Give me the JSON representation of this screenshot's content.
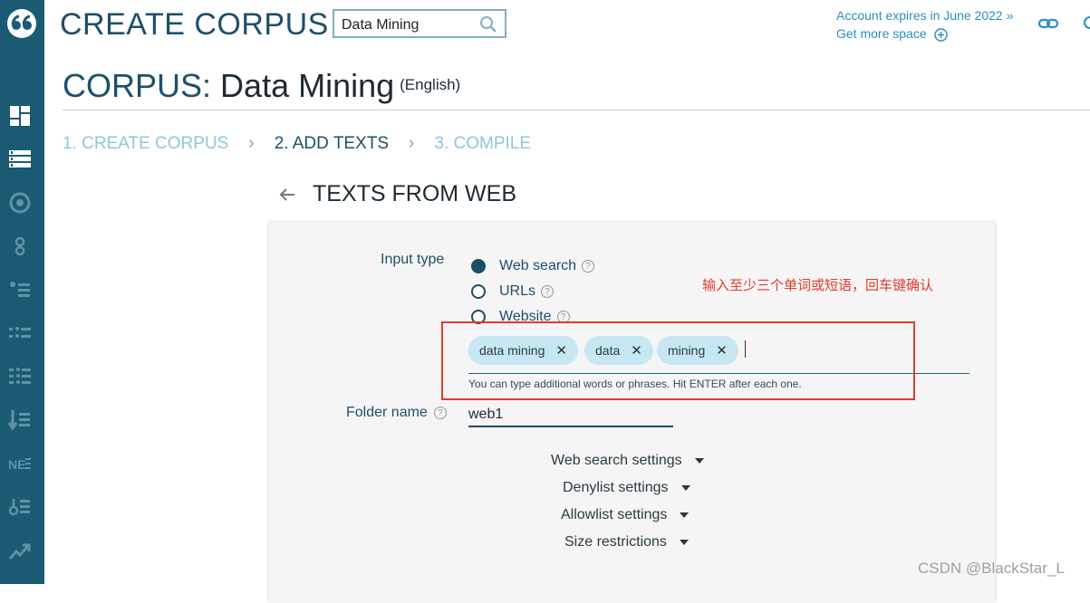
{
  "header": {
    "title": "CREATE CORPUS",
    "search_value": "Data Mining",
    "account_expires": "Account expires in June 2022 »",
    "get_more_space": "Get more space"
  },
  "corpus": {
    "label": "CORPUS:",
    "name": "Data Mining",
    "language": "(English)"
  },
  "steps": [
    {
      "label": "1. CREATE CORPUS",
      "active": false
    },
    {
      "label": "2. ADD TEXTS",
      "active": true
    },
    {
      "label": "3. COMPILE",
      "active": false
    }
  ],
  "section": {
    "title": "TEXTS FROM WEB"
  },
  "form": {
    "input_type_label": "Input type",
    "input_types": [
      {
        "label": "Web search",
        "selected": true
      },
      {
        "label": "URLs",
        "selected": false
      },
      {
        "label": "Website",
        "selected": false
      }
    ],
    "help_mark": "?",
    "annotation": "输入至少三个单词或短语，回车键确认",
    "chips": [
      {
        "label": "data mining"
      },
      {
        "label": "data"
      },
      {
        "label": "mining"
      }
    ],
    "chip_remove": "✕",
    "hint": "You can type additional words or phrases. Hit ENTER after each one.",
    "folder_label": "Folder name",
    "folder_value": "web1",
    "settings": [
      "Web search settings",
      "Denylist settings",
      "Allowlist settings",
      "Size restrictions"
    ]
  },
  "watermark": "CSDN @BlackStar_L",
  "colors": {
    "sidebar": "#1b5a73",
    "accent": "#1e4f6a",
    "link": "#2a8fbf",
    "chip": "#c7e8f3",
    "highlight_box": "#e23b33"
  },
  "sidebar_icons": [
    "logo-icon",
    "dashboard-icon",
    "corpus-list-icon",
    "target-icon",
    "concordance-icon",
    "wordlist-icon",
    "keywords-icon",
    "ngrams-icon",
    "sort-icon",
    "ne-icon",
    "terms-icon",
    "trends-icon"
  ]
}
